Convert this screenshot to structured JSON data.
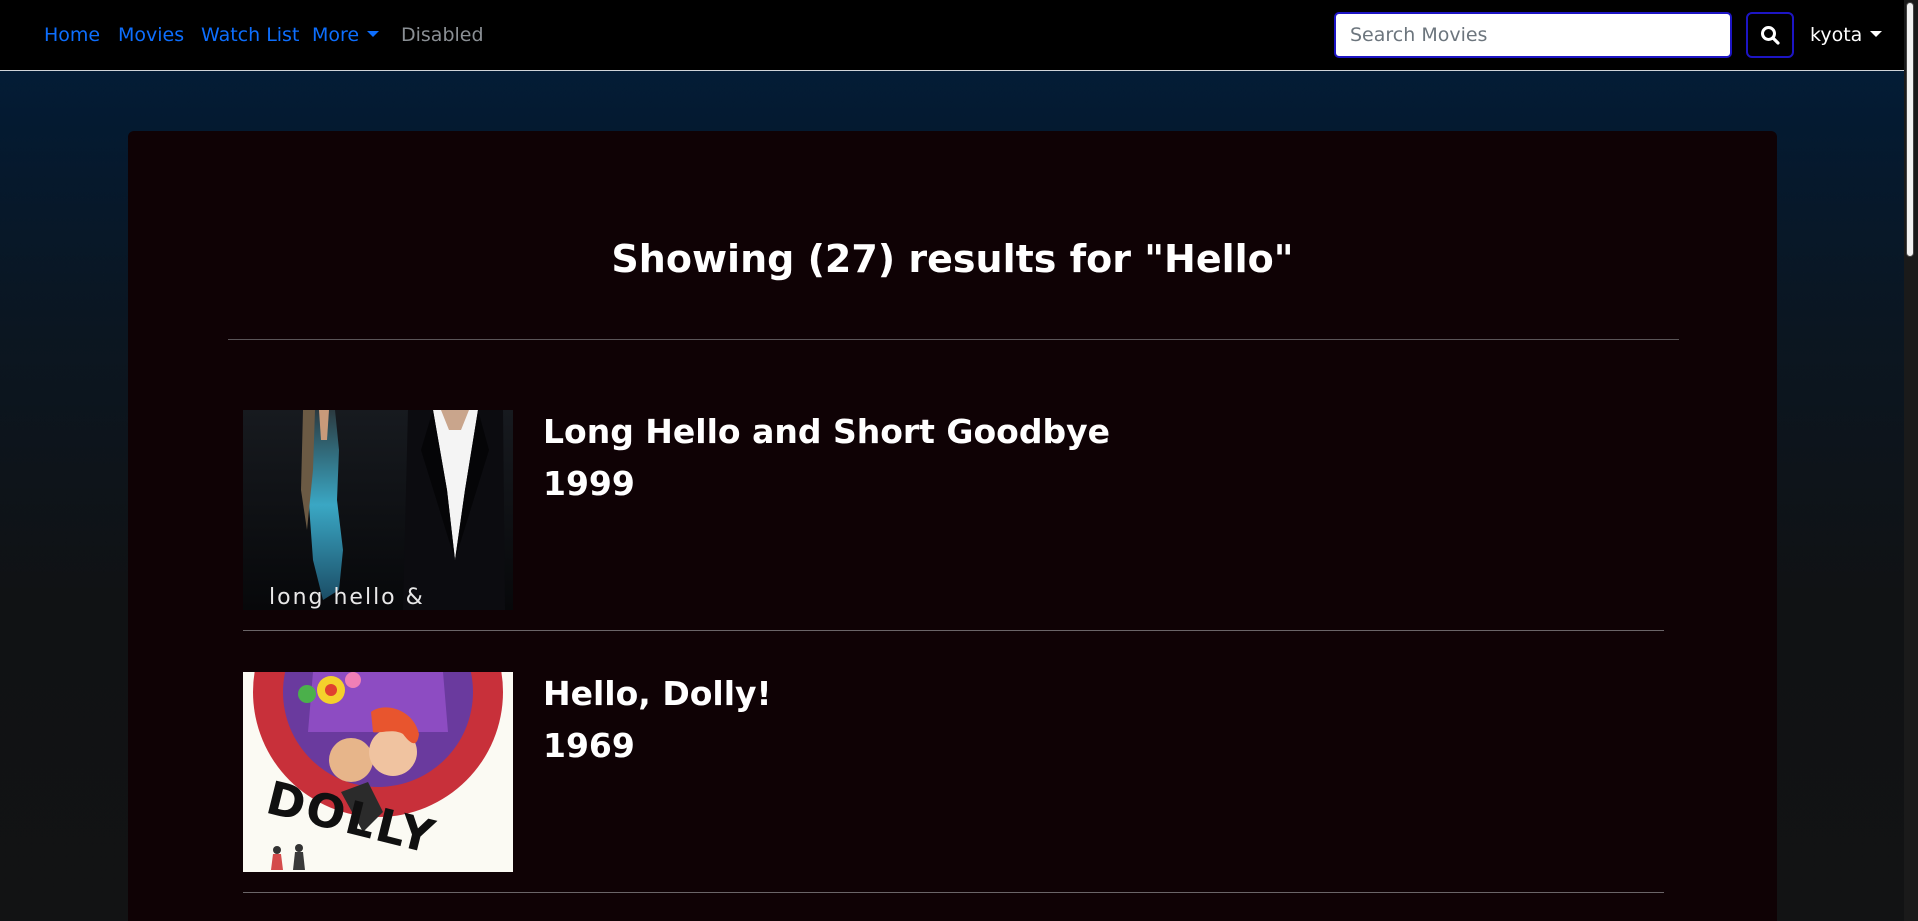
{
  "nav": {
    "links": [
      "Home",
      "Movies",
      "Watch List",
      "More",
      "Disabled"
    ],
    "search_placeholder": "Search Movies",
    "user": "kyota"
  },
  "results": {
    "heading": "Showing (27) results for \"Hello\"",
    "items": [
      {
        "title": "Long Hello and Short Goodbye",
        "year": "1999",
        "poster_text": "long hello &"
      },
      {
        "title": "Hello, Dolly!",
        "year": "1969",
        "poster_text": "DOLLY"
      }
    ]
  },
  "colors": {
    "nav_link": "#0d6efd",
    "nav_disabled": "#8a8f94",
    "search_border": "#1d15c4",
    "panel_background": "#0f0205",
    "page_gradient_top": "#02203d",
    "page_gradient_bottom": "#121314"
  },
  "icons": {
    "search_button": "search-icon",
    "more_dropdown": "caret-down-icon",
    "user_dropdown": "caret-down-icon"
  }
}
